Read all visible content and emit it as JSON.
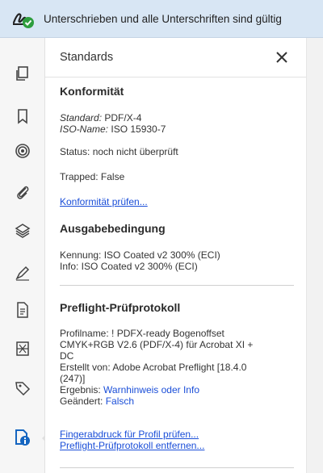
{
  "banner": {
    "text": "Unterschrieben und alle Unterschriften sind gültig"
  },
  "toolbar": {
    "items": [
      {
        "name": "pages-icon"
      },
      {
        "name": "bookmark-icon"
      },
      {
        "name": "layers-target-icon"
      },
      {
        "name": "attachment-icon"
      },
      {
        "name": "layers-icon"
      },
      {
        "name": "signature-pen-icon"
      },
      {
        "name": "document-icon"
      },
      {
        "name": "compare-icon"
      },
      {
        "name": "tag-icon"
      },
      {
        "name": "standards-icon"
      }
    ]
  },
  "panel": {
    "title": "Standards",
    "conformity": {
      "heading": "Konformität",
      "standard_label": "Standard:",
      "standard_value": "PDF/X-4",
      "iso_label": "ISO-Name:",
      "iso_value": "ISO 15930-7",
      "status": "Status: noch nicht überprüft",
      "trapped": "Trapped: False",
      "check_link": "Konformität prüfen..."
    },
    "output": {
      "heading": "Ausgabebedingung",
      "id_line": "Kennung: ISO Coated v2 300% (ECI)",
      "info_line": "Info: ISO Coated v2 300% (ECI)"
    },
    "preflight": {
      "heading": "Preflight-Prüfprotokoll",
      "profile_line1": "Profilname: ! PDFX-ready Bogenoffset",
      "profile_line2": "CMYK+RGB V2.6 (PDF/X-4) für Acrobat XI +",
      "profile_line3": "DC",
      "created_line1": "Erstellt von: Adobe Acrobat Preflight [18.4.0",
      "created_line2": "(247)]",
      "result_label": "Ergebnis:",
      "result_value": "Warnhinweis oder Info",
      "changed_label": "Geändert:",
      "changed_value": "Falsch",
      "link_fingerprint": "Fingerabdruck für Profil prüfen...",
      "link_remove": "Preflight-Prüfprotokoll entfernen..."
    }
  },
  "colors": {
    "banner_bg": "#d8e6f4",
    "link": "#1a4ed8",
    "accent_blue": "#1565c0"
  }
}
